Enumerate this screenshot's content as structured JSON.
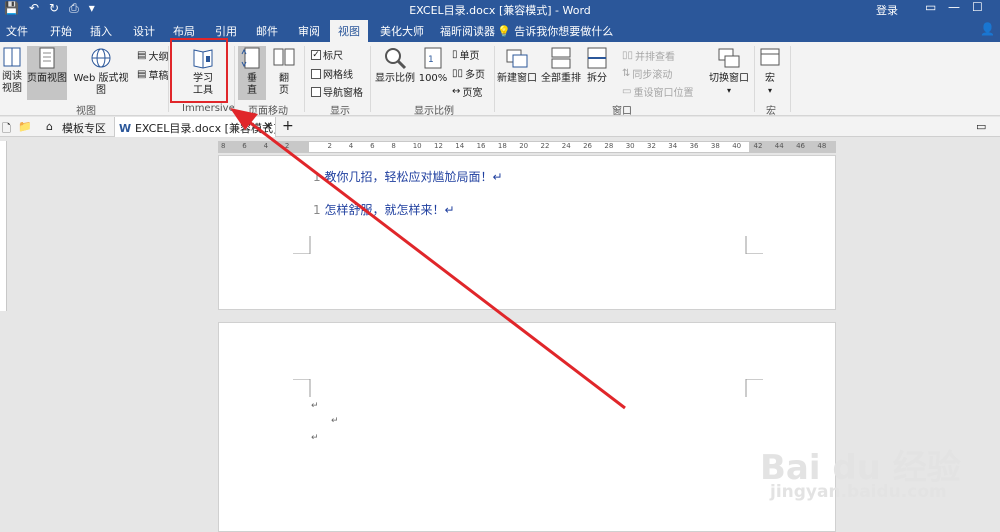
{
  "window": {
    "title": "EXCEL目录.docx [兼容模式] - Word",
    "login_label": "登录"
  },
  "ribbon_tabs": [
    "文件",
    "开始",
    "插入",
    "设计",
    "布局",
    "引用",
    "邮件",
    "审阅",
    "视图",
    "美化大师",
    "福昕阅读器"
  ],
  "tell_me": "告诉我你想要做什么",
  "ribbon": {
    "views": {
      "read": "阅读\n视图",
      "print_layout": "页面视图",
      "web": "Web 版式视图",
      "outline": "大纲",
      "draft": "草稿",
      "label": "视图"
    },
    "immersive": {
      "learning_tools": "学习\n工具",
      "label": "Immersive"
    },
    "page_movement": {
      "vertical": "垂\n直",
      "side": "翻\n页",
      "label": "页面移动"
    },
    "show": {
      "ruler": "标尺",
      "gridlines": "网格线",
      "nav_pane": "导航窗格",
      "label": "显示",
      "ruler_checked": "✓"
    },
    "zoom": {
      "zoom": "显示比例",
      "hundred": "100%",
      "one_page": "单页",
      "multi_page": "多页",
      "page_width": "页宽",
      "label": "显示比例"
    },
    "window": {
      "new_window": "新建窗口",
      "arrange_all": "全部重排",
      "split": "拆分",
      "side_by_side": "并排查看",
      "sync_scroll": "同步滚动",
      "reset_pos": "重设窗口位置",
      "switch": "切换窗口",
      "label": "窗口"
    },
    "macros": {
      "macro": "宏",
      "label": "宏"
    }
  },
  "doc_tabs": {
    "template": "模板专区",
    "document": "EXCEL目录.docx [兼容模式]",
    "new_tab": "+"
  },
  "ruler_ticks": [
    "8",
    "6",
    "4",
    "2",
    "",
    "2",
    "4",
    "6",
    "8",
    "10",
    "12",
    "14",
    "16",
    "18",
    "20",
    "22",
    "24",
    "26",
    "28",
    "30",
    "32",
    "34",
    "36",
    "38",
    "40",
    "42",
    "44",
    "46",
    "48"
  ],
  "page1": {
    "line1": "教你几招，轻松应对尴尬局面！↵",
    "line2": "怎样舒服，就怎样来！↵"
  },
  "page2": {
    "mark1": "↵",
    "mark2": "↵",
    "mark3": "↵"
  },
  "watermark": {
    "brand": "Bai du 经验",
    "url": "jingyan.baidu.com"
  },
  "colors": {
    "accent": "#2b579a",
    "annotation": "#e0262a"
  }
}
